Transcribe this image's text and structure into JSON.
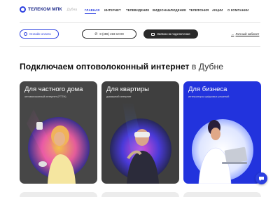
{
  "header": {
    "logo_text": "ТЕЛЕКОМ МПК",
    "city_label": "Дубна",
    "nav": [
      "ГЛАВНАЯ",
      "ИНТЕРНЕТ",
      "ТЕЛЕВИДЕНИЕ",
      "ВИДЕОНАБЛЮДЕНИЕ",
      "ТЕЛЕФОНИЯ",
      "АКЦИИ",
      "О КОМПАНИИ"
    ],
    "active_nav": "ГЛАВНАЯ"
  },
  "actions": {
    "pay_label": "Онлайн-оплата",
    "phone_label": "8 (496) 219-10-00",
    "request_label": "Заявка на подключение",
    "cabinet_label": "Личный кабинет"
  },
  "page": {
    "heading_main": "Подключаем оптоволоконный интернет",
    "heading_city": "в Дубне"
  },
  "cards": [
    {
      "title": "Для частного дома",
      "subtitle": "оптоволоконный интернет (FTTH)"
    },
    {
      "title": "Для квартиры",
      "subtitle": "домашний интернет"
    },
    {
      "title": "Для бизнеса",
      "subtitle": "интеграторы цифровых решений"
    }
  ],
  "colors": {
    "accent": "#2b3fe0",
    "card_dark": "#474747",
    "card_business": "#2233dd"
  },
  "icons": {
    "pay": "wallet-icon",
    "phone": "phone-icon",
    "request": "document-icon",
    "cabinet": "arrow-right-icon",
    "chat": "chat-icon"
  }
}
